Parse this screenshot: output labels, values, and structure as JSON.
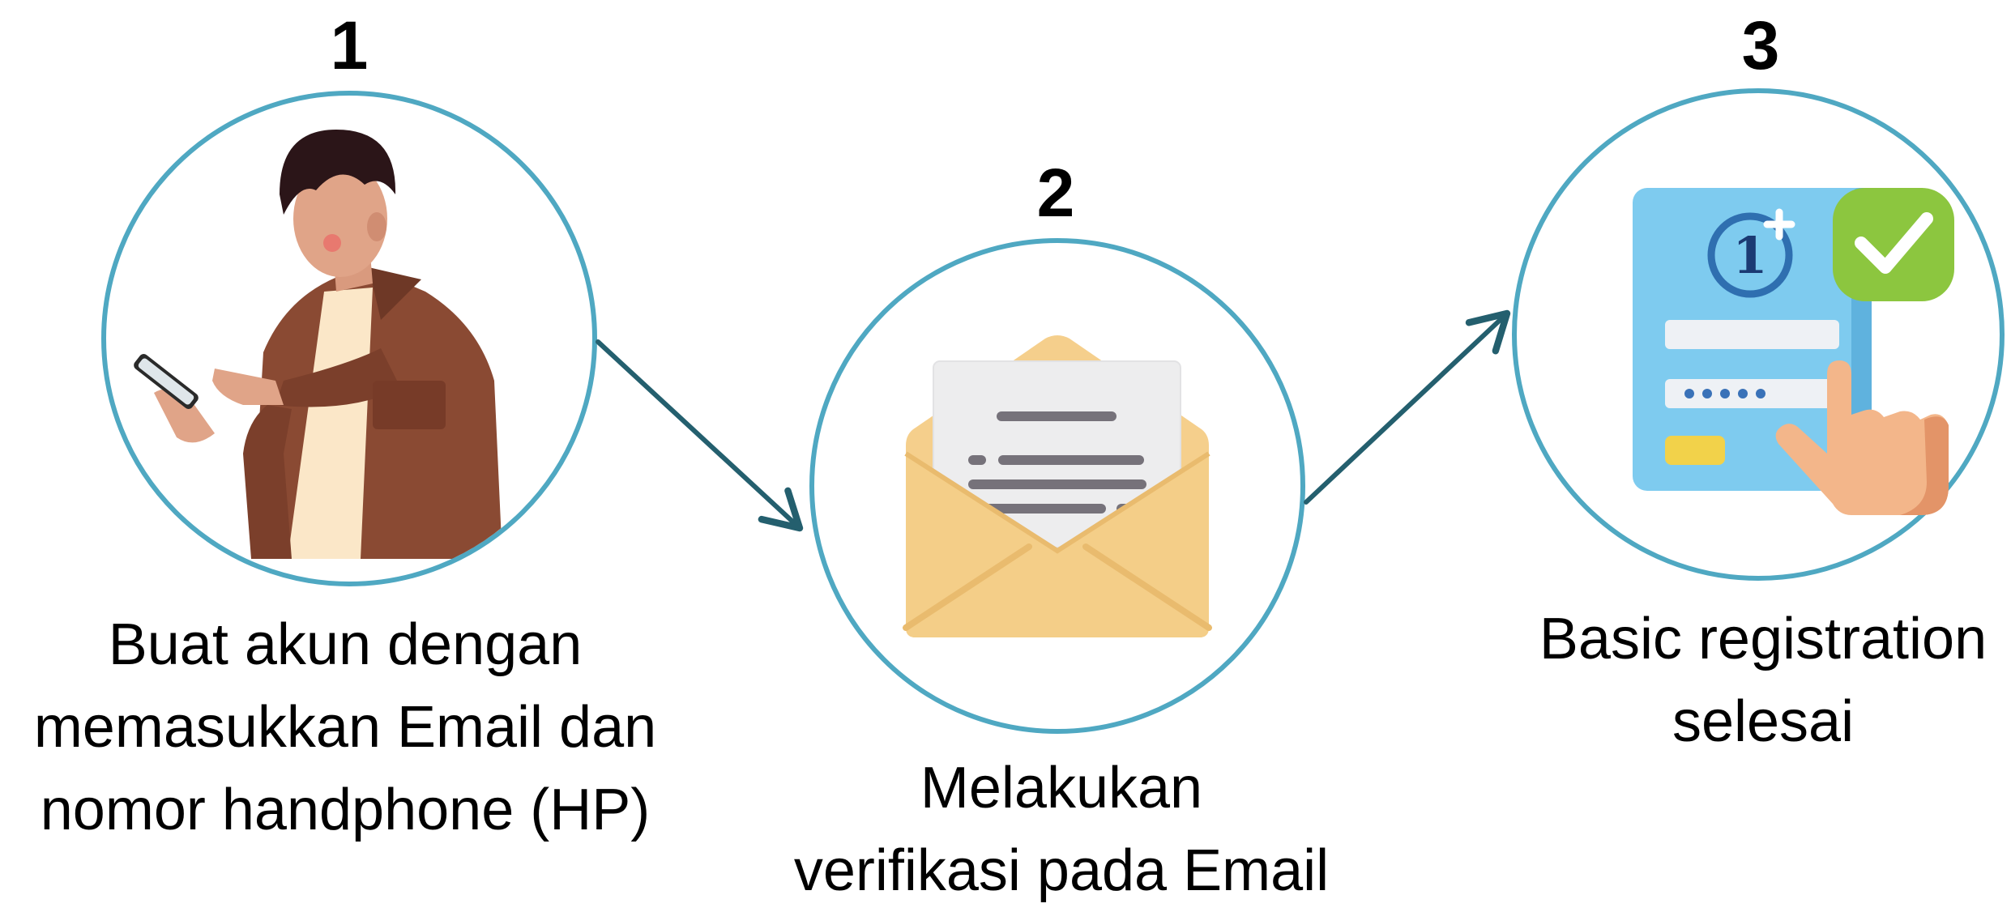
{
  "colors": {
    "circle_stroke": "#4fa8c2",
    "arrow": "#245f6e",
    "text": "#000000",
    "envelope": "#f5cf8c",
    "card": "#7ecbef",
    "check_badge": "#8cc63f",
    "jacket": "#8a4a33"
  },
  "steps": [
    {
      "number": "1",
      "icon": "person-with-phone-icon",
      "caption_lines": [
        "Buat akun dengan",
        "memasukkan Email dan",
        "nomor handphone (HP)"
      ]
    },
    {
      "number": "2",
      "icon": "open-envelope-letter-icon",
      "caption_lines": [
        "Melakukan",
        "verifikasi pada Email"
      ]
    },
    {
      "number": "3",
      "icon": "registration-form-check-icon",
      "caption_lines": [
        "Basic registration",
        "selesai"
      ]
    }
  ],
  "connectors": [
    "arrow-1-to-2",
    "arrow-2-to-3"
  ]
}
